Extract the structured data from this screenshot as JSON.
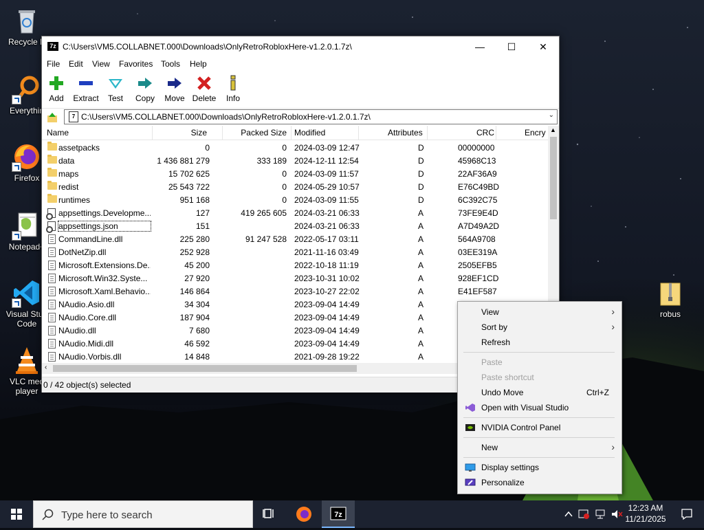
{
  "desktop": {
    "icons": [
      {
        "label": "Recycle Bin",
        "shown_label": "Recycle B",
        "icon": "recycle-bin-icon"
      },
      {
        "label": "Everything",
        "shown_label": "Everythin",
        "icon": "everything-search-icon"
      },
      {
        "label": "Firefox",
        "shown_label": "Firefox",
        "icon": "firefox-icon"
      },
      {
        "label": "Notepad++",
        "shown_label": "Notepad+",
        "icon": "notepadpp-icon"
      },
      {
        "label": "Visual Studio Code",
        "shown_label": "Visual Stud\nCode",
        "icon": "vscode-icon"
      },
      {
        "label": "VLC media player",
        "shown_label": "VLC med\nplayer",
        "icon": "vlc-icon"
      },
      {
        "label": "robus",
        "shown_label": "robus",
        "icon": "zip-folder-icon"
      }
    ]
  },
  "window": {
    "title": "C:\\Users\\VM5.COLLABNET.000\\Downloads\\OnlyRetroRobloxHere-v1.2.0.1.7z\\",
    "app_logo": "7z",
    "controls": {
      "minimize": "—",
      "maximize": "☐",
      "close": "✕"
    },
    "menu": [
      "File",
      "Edit",
      "View",
      "Favorites",
      "Tools",
      "Help"
    ],
    "toolbar": [
      {
        "label": "Add",
        "icon": "add-icon",
        "color": "#22a822"
      },
      {
        "label": "Extract",
        "icon": "extract-icon",
        "color": "#1f3fbf"
      },
      {
        "label": "Test",
        "icon": "test-icon",
        "color": "#2bb6c8"
      },
      {
        "label": "Copy",
        "icon": "copy-icon",
        "color": "#1a8a8a"
      },
      {
        "label": "Move",
        "icon": "move-icon",
        "color": "#1a2a8a"
      },
      {
        "label": "Delete",
        "icon": "delete-icon",
        "color": "#d32020"
      },
      {
        "label": "Info",
        "icon": "info-icon",
        "color": "#d8c23a"
      }
    ],
    "path": "C:\\Users\\VM5.COLLABNET.000\\Downloads\\OnlyRetroRobloxHere-v1.2.0.1.7z\\",
    "columns": [
      "Name",
      "Size",
      "Packed Size",
      "Modified",
      "Attributes",
      "CRC",
      "Encry"
    ],
    "rows": [
      {
        "type": "folder",
        "name": "assetpacks",
        "size": "0",
        "packed": "0",
        "modified": "2024-03-09 12:47",
        "attr": "D",
        "crc": "00000000"
      },
      {
        "type": "folder",
        "name": "data",
        "size": "1 436 881 279",
        "packed": "333 189",
        "modified": "2024-12-11 12:54",
        "attr": "D",
        "crc": "45968C13"
      },
      {
        "type": "folder",
        "name": "maps",
        "size": "15 702 625",
        "packed": "0",
        "modified": "2024-03-09 11:57",
        "attr": "D",
        "crc": "22AF36A9"
      },
      {
        "type": "folder",
        "name": "redist",
        "size": "25 543 722",
        "packed": "0",
        "modified": "2024-05-29 10:57",
        "attr": "D",
        "crc": "E76C49BD"
      },
      {
        "type": "folder",
        "name": "runtimes",
        "size": "951 168",
        "packed": "0",
        "modified": "2024-03-09 11:55",
        "attr": "D",
        "crc": "6C392C75"
      },
      {
        "type": "cfg",
        "name": "appsettings.Developme...",
        "size": "127",
        "packed": "419 265 605",
        "modified": "2024-03-21 06:33",
        "attr": "A",
        "crc": "73FE9E4D"
      },
      {
        "type": "cfg",
        "name": "appsettings.json",
        "size": "151",
        "packed": "",
        "modified": "2024-03-21 06:33",
        "attr": "A",
        "crc": "A7D49A2D",
        "focused": true
      },
      {
        "type": "doc",
        "name": "CommandLine.dll",
        "size": "225 280",
        "packed": "91 247 528",
        "modified": "2022-05-17 03:11",
        "attr": "A",
        "crc": "564A9708"
      },
      {
        "type": "doc",
        "name": "DotNetZip.dll",
        "size": "252 928",
        "packed": "",
        "modified": "2021-11-16 03:49",
        "attr": "A",
        "crc": "03EE319A"
      },
      {
        "type": "doc",
        "name": "Microsoft.Extensions.De...",
        "size": "45 200",
        "packed": "",
        "modified": "2022-10-18 11:19",
        "attr": "A",
        "crc": "2505EFB5"
      },
      {
        "type": "doc",
        "name": "Microsoft.Win32.Syste...",
        "size": "27 920",
        "packed": "",
        "modified": "2023-10-31 10:02",
        "attr": "A",
        "crc": "928EF1CD"
      },
      {
        "type": "doc",
        "name": "Microsoft.Xaml.Behavio...",
        "size": "146 864",
        "packed": "",
        "modified": "2023-10-27 22:02",
        "attr": "A",
        "crc": "E41EF587"
      },
      {
        "type": "doc",
        "name": "NAudio.Asio.dll",
        "size": "34 304",
        "packed": "",
        "modified": "2023-09-04 14:49",
        "attr": "A",
        "crc": ""
      },
      {
        "type": "doc",
        "name": "NAudio.Core.dll",
        "size": "187 904",
        "packed": "",
        "modified": "2023-09-04 14:49",
        "attr": "A",
        "crc": ""
      },
      {
        "type": "doc",
        "name": "NAudio.dll",
        "size": "7 680",
        "packed": "",
        "modified": "2023-09-04 14:49",
        "attr": "A",
        "crc": ""
      },
      {
        "type": "doc",
        "name": "NAudio.Midi.dll",
        "size": "46 592",
        "packed": "",
        "modified": "2023-09-04 14:49",
        "attr": "A",
        "crc": "C"
      },
      {
        "type": "doc",
        "name": "NAudio.Vorbis.dll",
        "size": "14 848",
        "packed": "",
        "modified": "2021-09-28 19:22",
        "attr": "A",
        "crc": ""
      }
    ],
    "status": "0 / 42 object(s) selected"
  },
  "context_menu": {
    "items": [
      {
        "label": "View",
        "arrow": "›",
        "enabled": true
      },
      {
        "label": "Sort by",
        "arrow": "›",
        "enabled": true
      },
      {
        "label": "Refresh",
        "enabled": true
      },
      {
        "separator": true
      },
      {
        "label": "Paste",
        "enabled": false
      },
      {
        "label": "Paste shortcut",
        "enabled": false
      },
      {
        "label": "Undo Move",
        "shortcut": "Ctrl+Z",
        "enabled": true
      },
      {
        "label": "Open with Visual Studio",
        "icon": "visual-studio-icon",
        "enabled": true
      },
      {
        "separator": true
      },
      {
        "label": "NVIDIA Control Panel",
        "icon": "nvidia-icon",
        "enabled": true
      },
      {
        "separator": true
      },
      {
        "label": "New",
        "arrow": "›",
        "enabled": true
      },
      {
        "separator": true
      },
      {
        "label": "Display settings",
        "icon": "display-icon",
        "enabled": true
      },
      {
        "label": "Personalize",
        "icon": "personalize-icon",
        "enabled": true
      }
    ]
  },
  "taskbar": {
    "search_placeholder": "Type here to search",
    "time": "12:23 AM",
    "date": "11/21/2025",
    "accent": "#7ab7ff"
  }
}
